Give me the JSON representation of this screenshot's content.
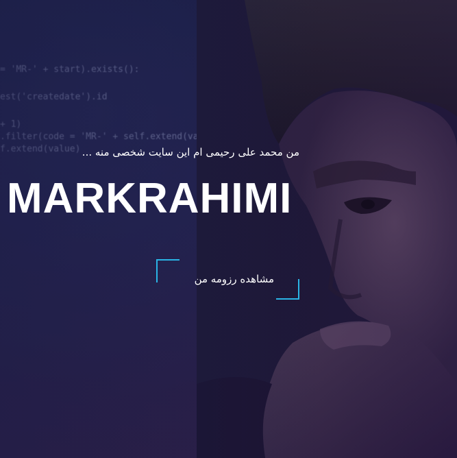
{
  "hero": {
    "tagline": "من محمد علی رحیمی ام این سایت شخصی منه ...",
    "brand": "MARKRAHIMI",
    "cta_label": "مشاهده رزومه من"
  },
  "code": {
    "line1": "= 'MR-' + start).exists():",
    "line2": "est('createdate').id",
    "line3": "+ 1)",
    "line4": ".filter(code = 'MR-' + self.extend(value)).exists():",
    "line5": "f.extend(value)"
  },
  "colors": {
    "accent": "#2ab5e6",
    "background": "#1e1a3d"
  }
}
